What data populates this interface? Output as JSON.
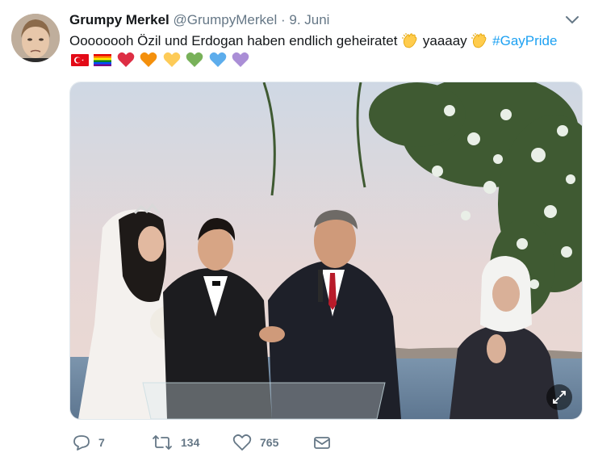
{
  "author": {
    "name": "Grumpy Merkel",
    "handle": "@GrumpyMerkel",
    "separator": "·",
    "date": "9. Juni"
  },
  "tweet": {
    "text_before": "Oooooooh Özil und Erdogan haben endlich geheiratet ",
    "text_middle": " yaaaay ",
    "hashtag": "#GayPride",
    "emoji_row": [
      "turkey-flag",
      "rainbow-flag",
      "red-heart",
      "orange-heart",
      "yellow-heart",
      "green-heart",
      "blue-heart",
      "purple-heart"
    ]
  },
  "media": {
    "alt": "Wedding ceremony photo"
  },
  "actions": {
    "reply_count": "7",
    "retweet_count": "134",
    "like_count": "765"
  },
  "colors": {
    "accent": "#1da1f2",
    "muted": "#657786",
    "text": "#14171a"
  }
}
